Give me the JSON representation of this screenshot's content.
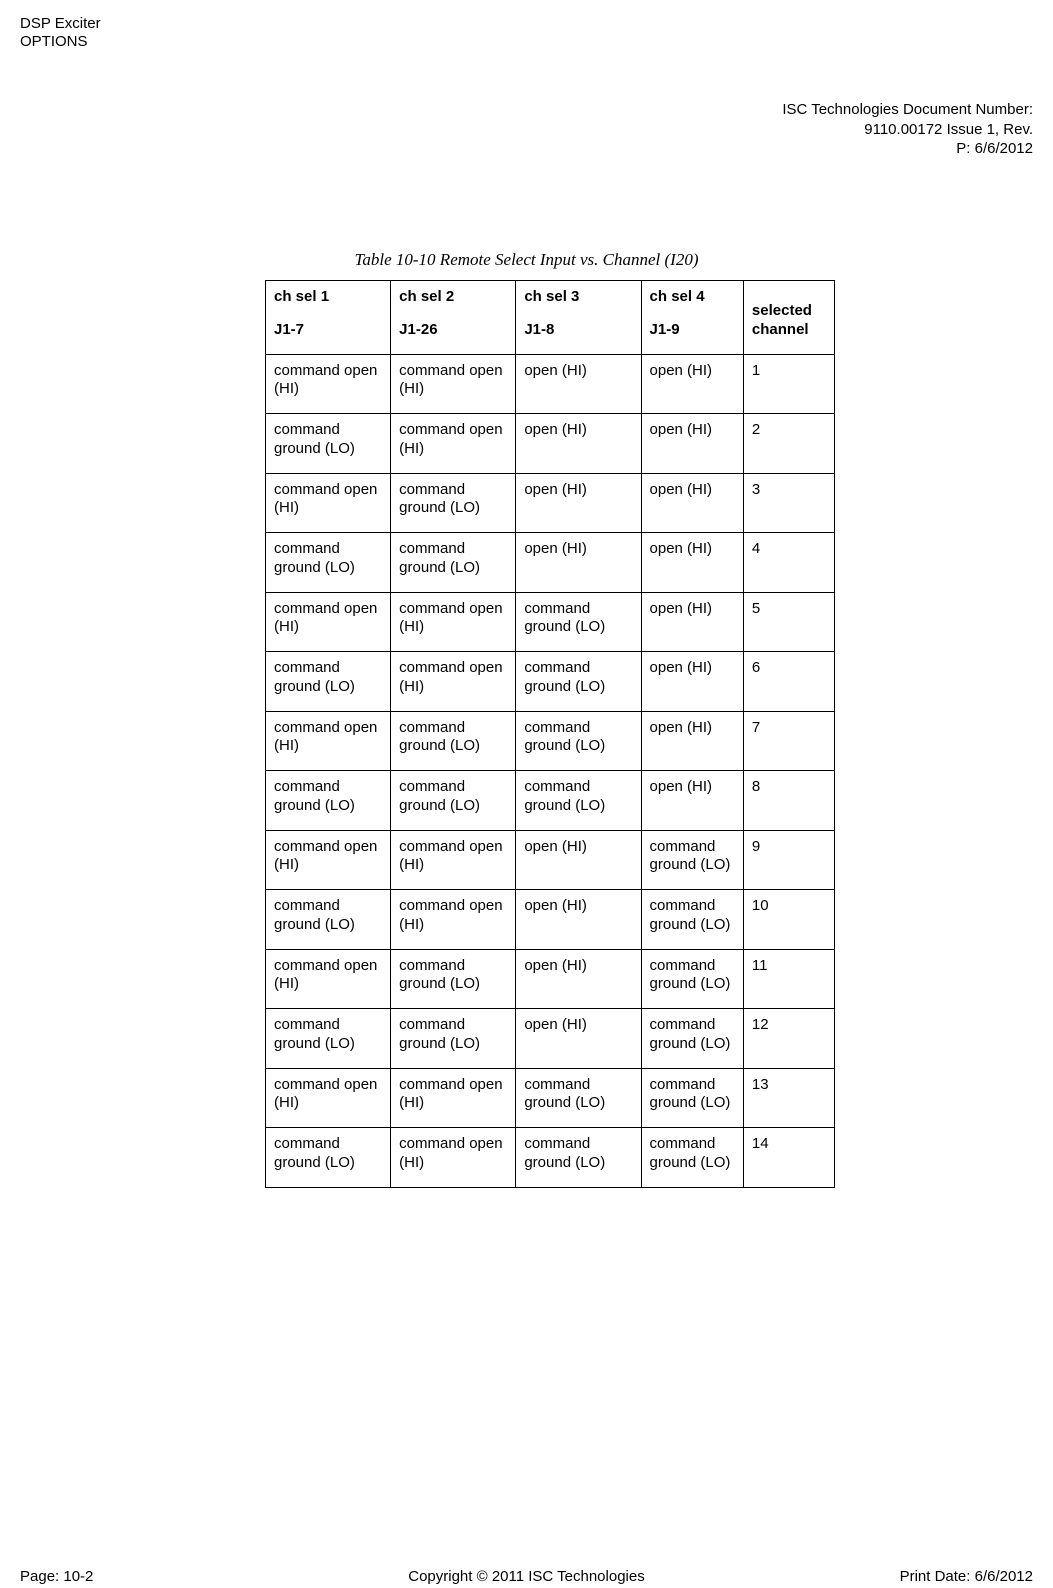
{
  "header": {
    "line1": "DSP Exciter",
    "line2": "OPTIONS",
    "right1": "ISC Technologies Document Number:",
    "right2": "9110.00172 Issue 1, Rev.",
    "right3": "P: 6/6/2012"
  },
  "caption": "Table 10-10 Remote Select Input vs. Channel (I20)",
  "columns": [
    {
      "top": "ch sel 1",
      "bottom": "J1-7"
    },
    {
      "top": "ch sel 2",
      "bottom": "J1-26"
    },
    {
      "top": "ch sel 3",
      "bottom": "J1-8"
    },
    {
      "top": "ch sel 4",
      "bottom": "J1-9"
    },
    {
      "top": "",
      "bottom": "selected channel"
    }
  ],
  "rows": [
    {
      "c1": "command open (HI)",
      "c2": "command open (HI)",
      "c3": "open (HI)",
      "c4": "open (HI)",
      "c5": "1"
    },
    {
      "c1": "command ground (LO)",
      "c2": "command open (HI)",
      "c3": "open (HI)",
      "c4": "open (HI)",
      "c5": "2"
    },
    {
      "c1": "command open (HI)",
      "c2": "command ground (LO)",
      "c3": "open (HI)",
      "c4": "open (HI)",
      "c5": "3"
    },
    {
      "c1": "command ground (LO)",
      "c2": "command ground (LO)",
      "c3": "open (HI)",
      "c4": "open (HI)",
      "c5": "4"
    },
    {
      "c1": "command open (HI)",
      "c2": "command open (HI)",
      "c3": "command ground (LO)",
      "c4": "open (HI)",
      "c5": "5"
    },
    {
      "c1": "command ground (LO)",
      "c2": "command open (HI)",
      "c3": "command ground (LO)",
      "c4": "open (HI)",
      "c5": "6"
    },
    {
      "c1": "command open (HI)",
      "c2": "command ground (LO)",
      "c3": "command ground (LO)",
      "c4": "open (HI)",
      "c5": "7"
    },
    {
      "c1": "command ground (LO)",
      "c2": "command ground (LO)",
      "c3": "command ground (LO)",
      "c4": "open (HI)",
      "c5": "8"
    },
    {
      "c1": "command open (HI)",
      "c2": "command open (HI)",
      "c3": "open (HI)",
      "c4": "command ground (LO)",
      "c5": "9"
    },
    {
      "c1": "command ground (LO)",
      "c2": "command open (HI)",
      "c3": "open (HI)",
      "c4": "command ground (LO)",
      "c5": "10"
    },
    {
      "c1": "command open (HI)",
      "c2": "command ground (LO)",
      "c3": "open (HI)",
      "c4": "command ground (LO)",
      "c5": "11"
    },
    {
      "c1": "command ground (LO)",
      "c2": "command ground (LO)",
      "c3": "open (HI)",
      "c4": "command ground (LO)",
      "c5": "12"
    },
    {
      "c1": "command open (HI)",
      "c2": "command open (HI)",
      "c3": "command ground (LO)",
      "c4": "command ground (LO)",
      "c5": "13"
    },
    {
      "c1": "command ground (LO)",
      "c2": "command open (HI)",
      "c3": "command ground (LO)",
      "c4": "command ground (LO)",
      "c5": "14"
    }
  ],
  "footer": {
    "left": "Page: 10-2",
    "center": "Copyright © 2011 ISC Technologies",
    "right": "Print Date: 6/6/2012"
  }
}
